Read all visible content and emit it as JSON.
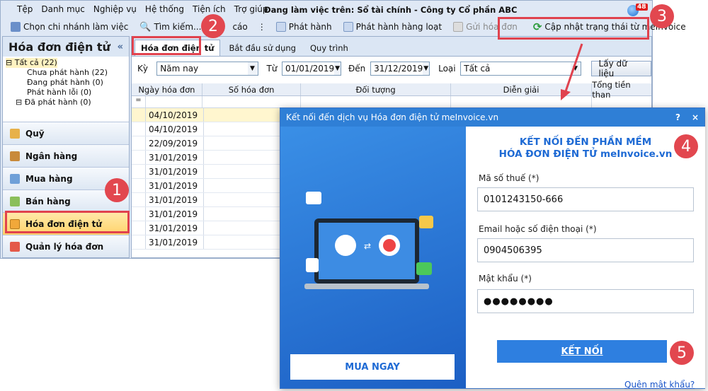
{
  "menu": [
    "Tệp",
    "Danh mục",
    "Nghiệp vụ",
    "Hệ thống",
    "Tiện ích",
    "Trợ giúp"
  ],
  "window_title": "Đang làm việc trên: Sổ tài chính - Công ty Cổ phần ABC",
  "notification_count": "48",
  "toolbar": {
    "branch": "Chọn chi nhánh làm việc",
    "search": "Tìm kiếm...",
    "report": "cáo",
    "issue": "Phát hành",
    "issue_batch": "Phát hành hàng loạt",
    "send": "Gửi hóa đơn",
    "update": "Cập nhật trạng thái từ meInvoice"
  },
  "sidebar": {
    "title": "Hóa đơn điện tử",
    "tree": [
      "Tất cả (22)",
      "Chưa phát hành (22)",
      "Đang phát hành (0)",
      "Phát hành lỗi (0)",
      "Đã phát hành (0)"
    ],
    "nav": [
      "Quỹ",
      "Ngân hàng",
      "Mua hàng",
      "Bán hàng",
      "Hóa đơn điện tử",
      "Quản lý hóa đơn"
    ]
  },
  "tabs": [
    "Hóa đơn điện tử",
    "Bắt đầu sử dụng",
    "Quy trình"
  ],
  "filter": {
    "ky_label": "Kỳ",
    "ky_value": "Năm nay",
    "tu_label": "Từ",
    "tu_value": "01/01/2019",
    "den_label": "Đến",
    "den_value": "31/12/2019",
    "loai_label": "Loại",
    "loai_value": "Tất cả",
    "fetch": "Lấy dữ liệu"
  },
  "grid": {
    "headers": [
      "Ngày hóa đơn",
      "Số hóa đơn",
      "Đối tượng",
      "Diễn giải",
      "Tổng tiền than"
    ],
    "dates": [
      "04/10/2019",
      "04/10/2019",
      "22/09/2019",
      "31/01/2019",
      "31/01/2019",
      "31/01/2019",
      "31/01/2019",
      "31/01/2019",
      "31/01/2019",
      "31/01/2019"
    ]
  },
  "dialog": {
    "title": "Kết nối đến dịch vụ Hóa đơn điện tử meInvoice.vn",
    "help": "?",
    "close": "×",
    "heading1": "KẾT NỐI ĐẾN PHẦN MỀM",
    "heading2": "HÓA ĐƠN ĐIỆN TỬ meInvoice.vn",
    "tax_label": "Mã số thuế (*)",
    "tax_value": "0101243150-666",
    "email_label": "Email hoặc số điện thoại (*)",
    "email_value": "0904506395",
    "pass_label": "Mật khẩu (*)",
    "pass_value": "●●●●●●●●",
    "connect": "KẾT NỐI",
    "forgot": "Quên mật khẩu?",
    "buy": "MUA NGAY"
  },
  "steps": [
    "1",
    "2",
    "3",
    "4",
    "5"
  ],
  "colors": {
    "accent": "#e2474f",
    "blue": "#2e7fe0"
  }
}
